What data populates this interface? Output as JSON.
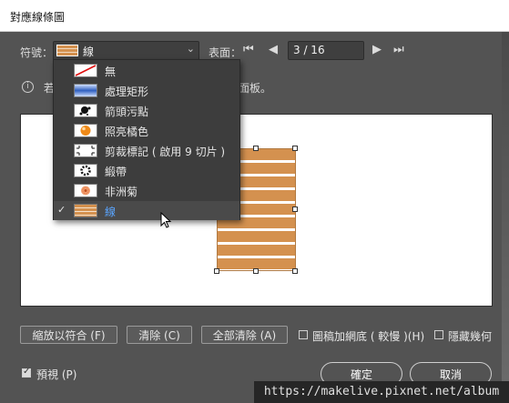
{
  "window": {
    "title": "對應線條圖"
  },
  "symbol": {
    "label": "符號：",
    "selected": "線"
  },
  "surface": {
    "label": "表面：",
    "page": "3 / 16"
  },
  "info": {
    "text_left": "若",
    "text_right": "面板。"
  },
  "dropdown": {
    "items": [
      {
        "label": "無",
        "icon": "none-swatch-icon"
      },
      {
        "label": "處理矩形",
        "icon": "blue-rectangle-icon"
      },
      {
        "label": "箭頭污點",
        "icon": "ink-splat-icon"
      },
      {
        "label": "照亮橘色",
        "icon": "orange-sphere-icon"
      },
      {
        "label": "剪裁標記 ( 啟用 9 切片 )",
        "icon": "crop-marks-icon"
      },
      {
        "label": "緞帶",
        "icon": "ribbon-icon"
      },
      {
        "label": "非洲菊",
        "icon": "daisy-icon"
      },
      {
        "label": "線",
        "icon": "stripes-icon",
        "selected": true
      }
    ]
  },
  "buttons": {
    "fit": "縮放以符合 (F)",
    "clear": "清除 (C)",
    "clear_all": "全部清除 (A)",
    "ok": "確定",
    "cancel": "取消"
  },
  "options": {
    "shade_art": "圖稿加網底 ( 較慢 )(H)",
    "hide_geometry": "隱藏幾何",
    "preview": "預視 (P)"
  },
  "watermark": "https://makelive.pixnet.net/album",
  "colors": {
    "accent": "#5aa5ff",
    "art_fill": "#d4914f",
    "dialog_bg": "#535353"
  }
}
